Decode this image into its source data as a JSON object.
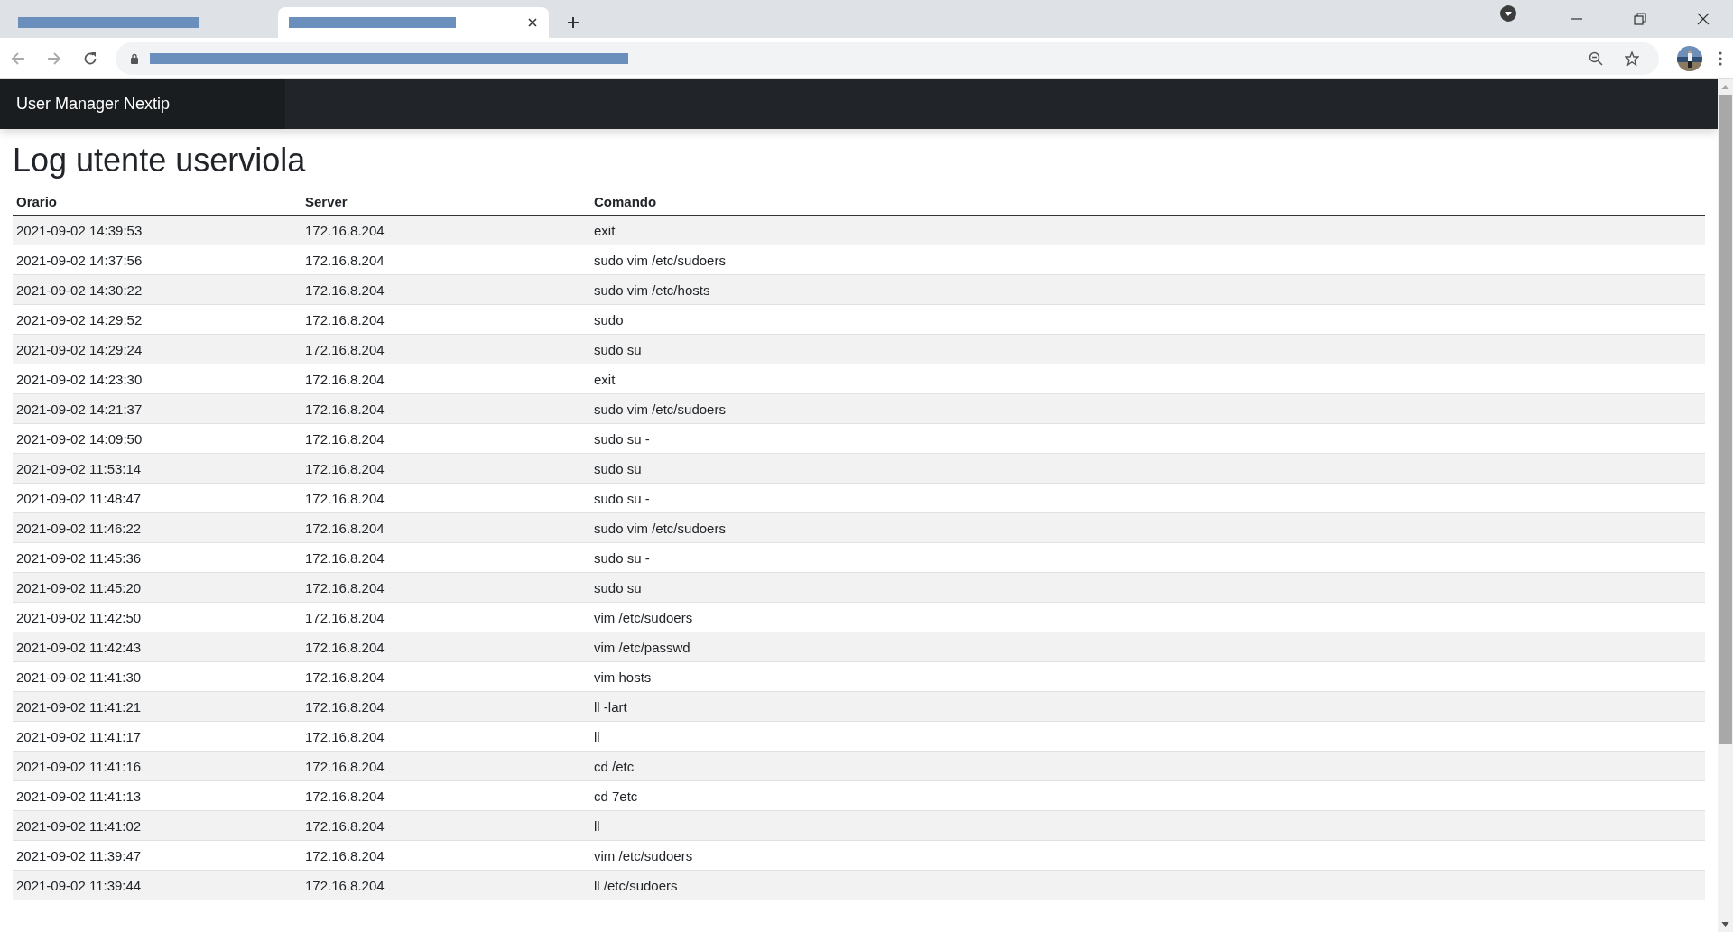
{
  "browser": {
    "tabs": [
      {
        "selected": false
      },
      {
        "selected": true
      }
    ]
  },
  "navbar": {
    "brand": "User Manager Nextip"
  },
  "heading": "Log utente userviola",
  "table": {
    "columns": [
      "Orario",
      "Server",
      "Comando"
    ],
    "rows": [
      [
        "2021-09-02 14:39:53",
        "172.16.8.204",
        "exit"
      ],
      [
        "2021-09-02 14:37:56",
        "172.16.8.204",
        "sudo vim /etc/sudoers"
      ],
      [
        "2021-09-02 14:30:22",
        "172.16.8.204",
        "sudo vim /etc/hosts"
      ],
      [
        "2021-09-02 14:29:52",
        "172.16.8.204",
        "sudo"
      ],
      [
        "2021-09-02 14:29:24",
        "172.16.8.204",
        "sudo su"
      ],
      [
        "2021-09-02 14:23:30",
        "172.16.8.204",
        "exit"
      ],
      [
        "2021-09-02 14:21:37",
        "172.16.8.204",
        "sudo vim /etc/sudoers"
      ],
      [
        "2021-09-02 14:09:50",
        "172.16.8.204",
        "sudo su -"
      ],
      [
        "2021-09-02 11:53:14",
        "172.16.8.204",
        "sudo su"
      ],
      [
        "2021-09-02 11:48:47",
        "172.16.8.204",
        "sudo su -"
      ],
      [
        "2021-09-02 11:46:22",
        "172.16.8.204",
        "sudo vim /etc/sudoers"
      ],
      [
        "2021-09-02 11:45:36",
        "172.16.8.204",
        "sudo su -"
      ],
      [
        "2021-09-02 11:45:20",
        "172.16.8.204",
        "sudo su"
      ],
      [
        "2021-09-02 11:42:50",
        "172.16.8.204",
        "vim /etc/sudoers"
      ],
      [
        "2021-09-02 11:42:43",
        "172.16.8.204",
        "vim /etc/passwd"
      ],
      [
        "2021-09-02 11:41:30",
        "172.16.8.204",
        "vim hosts"
      ],
      [
        "2021-09-02 11:41:21",
        "172.16.8.204",
        "ll -lart"
      ],
      [
        "2021-09-02 11:41:17",
        "172.16.8.204",
        "ll"
      ],
      [
        "2021-09-02 11:41:16",
        "172.16.8.204",
        "cd /etc"
      ],
      [
        "2021-09-02 11:41:13",
        "172.16.8.204",
        "cd 7etc"
      ],
      [
        "2021-09-02 11:41:02",
        "172.16.8.204",
        "ll"
      ],
      [
        "2021-09-02 11:39:47",
        "172.16.8.204",
        "vim /etc/sudoers"
      ],
      [
        "2021-09-02 11:39:44",
        "172.16.8.204",
        "ll /etc/sudoers"
      ]
    ]
  }
}
